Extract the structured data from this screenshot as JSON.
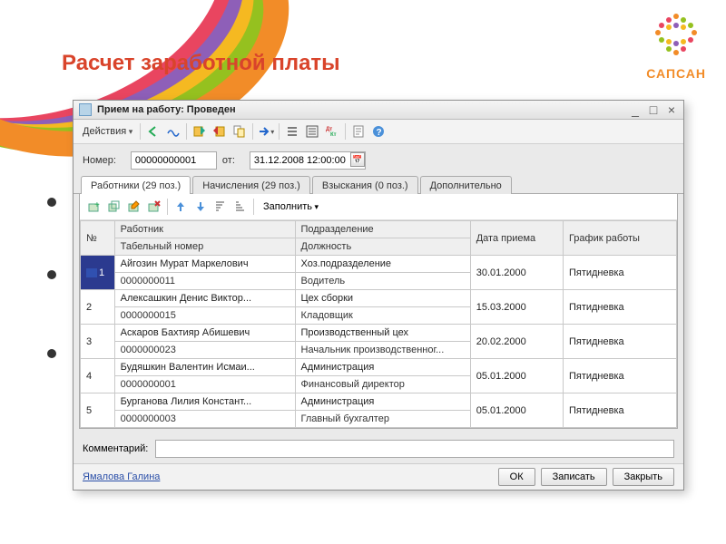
{
  "slide": {
    "title": "Расчет заработной платы",
    "brand": "САПСАН"
  },
  "window": {
    "title": "Прием на работу: Проведен",
    "menu_actions": "Действия",
    "number_label": "Номер:",
    "number_value": "00000000001",
    "date_label": "от:",
    "date_value": "31.12.2008 12:00:00",
    "comment_label": "Комментарий:",
    "comment_value": "",
    "user": "Ямалова Галина",
    "buttons": {
      "ok": "ОК",
      "write": "Записать",
      "close": "Закрыть"
    }
  },
  "tabs": [
    {
      "label": "Работники (29 поз.)",
      "active": true
    },
    {
      "label": "Начисления (29 поз.)"
    },
    {
      "label": "Взыскания (0 поз.)"
    },
    {
      "label": "Дополнительно"
    }
  ],
  "toolbar": {
    "fill": "Заполнить"
  },
  "grid": {
    "headers": {
      "n": "№",
      "worker": "Работник",
      "dept": "Подразделение",
      "date": "Дата приема",
      "schedule": "График работы",
      "tabno": "Табельный номер",
      "position": "Должность"
    },
    "rows": [
      {
        "n": "1",
        "worker": "Айгозин Мурат Маркелович",
        "tabno": "0000000011",
        "dept": "Хоз.подразделение",
        "position": "Водитель",
        "date": "30.01.2000",
        "schedule": "Пятидневка",
        "selected": true
      },
      {
        "n": "2",
        "worker": "Алексашкин Денис Виктор...",
        "tabno": "0000000015",
        "dept": "Цех сборки",
        "position": "Кладовщик",
        "date": "15.03.2000",
        "schedule": "Пятидневка"
      },
      {
        "n": "3",
        "worker": "Аскаров Бахтияр Абишевич",
        "tabno": "0000000023",
        "dept": "Производственный цех",
        "position": "Начальник производственног...",
        "date": "20.02.2000",
        "schedule": "Пятидневка"
      },
      {
        "n": "4",
        "worker": "Будяшкин Валентин Исмаи...",
        "tabno": "0000000001",
        "dept": "Администрация",
        "position": "Финансовый директор",
        "date": "05.01.2000",
        "schedule": "Пятидневка"
      },
      {
        "n": "5",
        "worker": "Бурганова Лилия Констант...",
        "tabno": "0000000003",
        "dept": "Администрация",
        "position": "Главный бухгалтер",
        "date": "05.01.2000",
        "schedule": "Пятидневка"
      }
    ]
  }
}
